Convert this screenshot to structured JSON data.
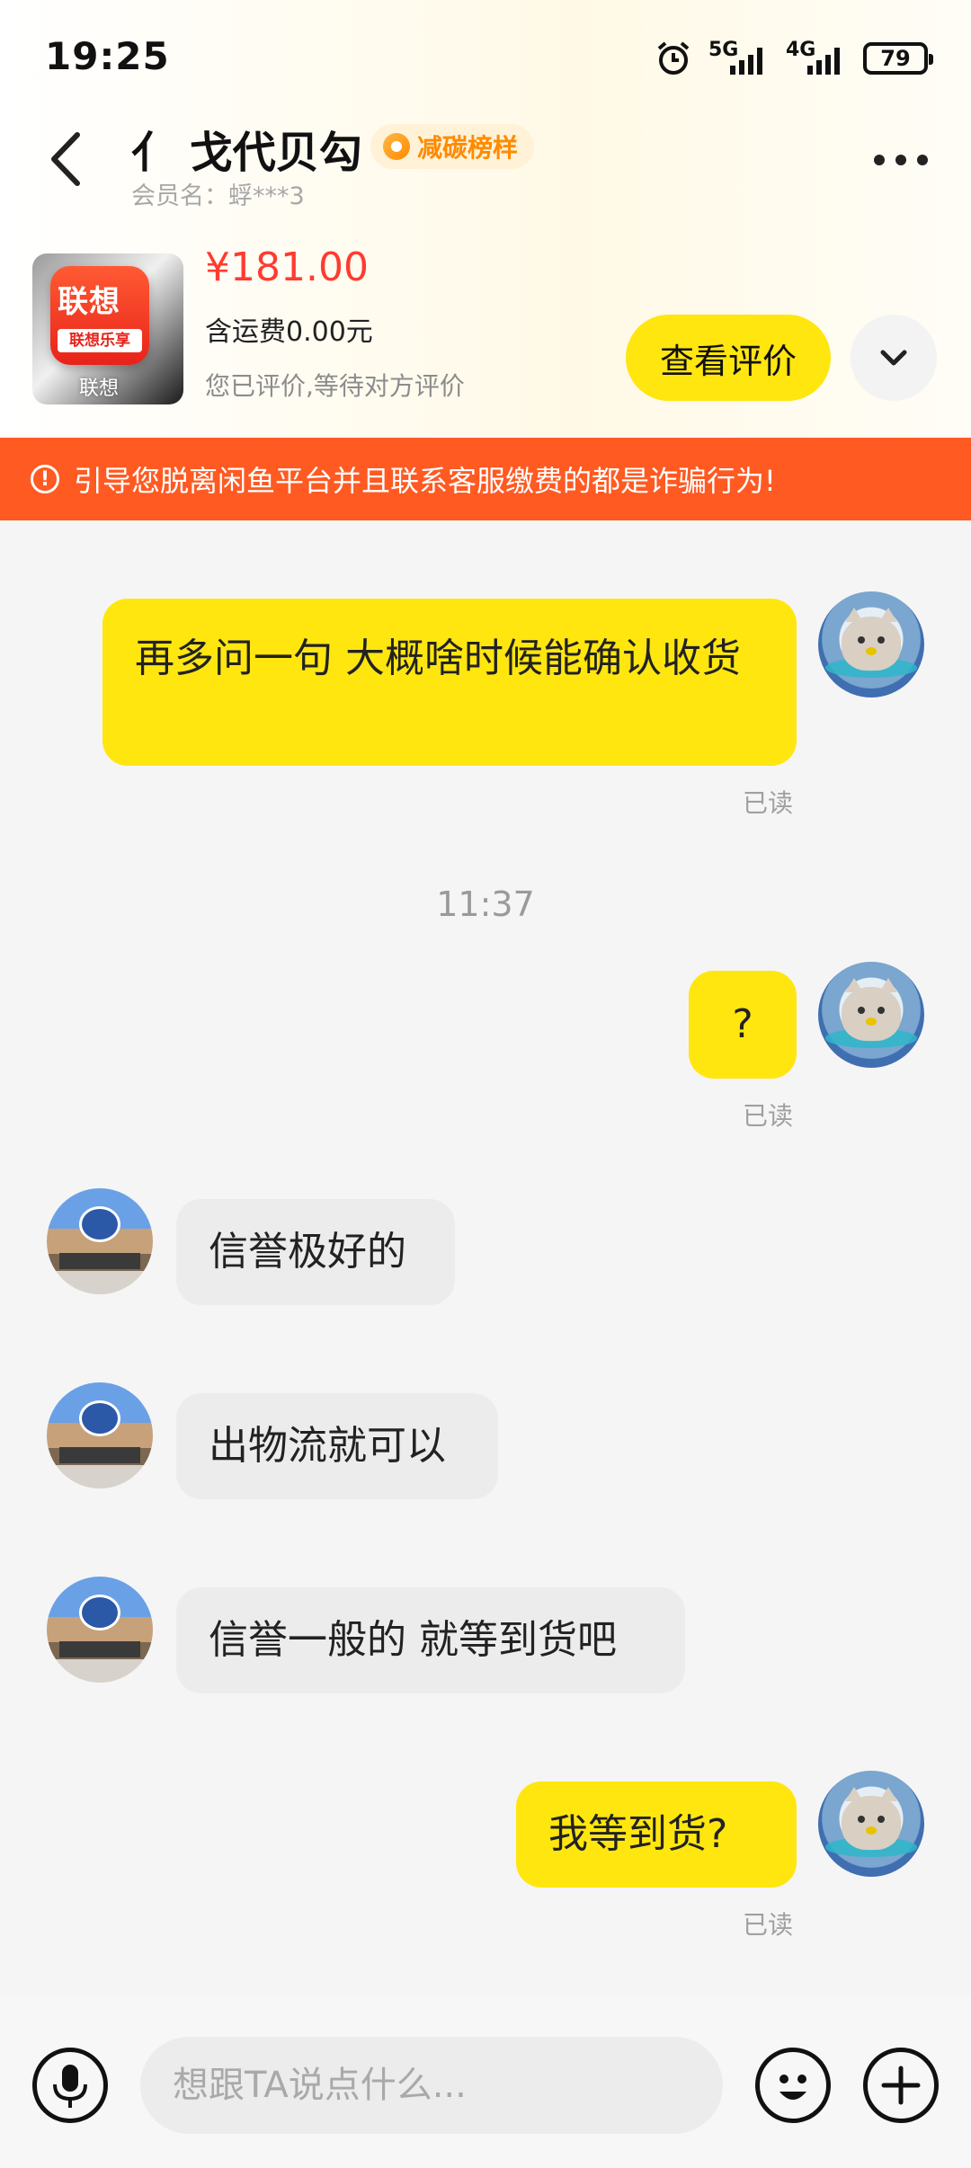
{
  "status_bar": {
    "time": "19:25",
    "net1": "5G",
    "net2": "4G",
    "battery": "79"
  },
  "header": {
    "title": "亻 戈代贝勾",
    "badge": "减碳榜样",
    "member": "会员名：蜉***3"
  },
  "product": {
    "thumb_big": "联想",
    "thumb_small": "联想乐享",
    "thumb_caption": "联想",
    "price": "¥181.00",
    "shipping": "含运费0.00元",
    "review_status": "您已评价,等待对方评价",
    "view_review_label": "查看评价"
  },
  "warning": "引导您脱离闲鱼平台并且联系客服缴费的都是诈骗行为!",
  "chat": {
    "m1": "再多问一句 大概啥时候能确认收货",
    "read1": "已读",
    "timestamp": "11:37",
    "m2": "?",
    "read2": "已读",
    "m3": "信誉极好的",
    "m4": "出物流就可以",
    "m5": "信誉一般的 就等到货吧",
    "m6": "我等到货?",
    "read3": "已读"
  },
  "input": {
    "placeholder": "想跟TA说点什么..."
  },
  "colors": {
    "accent": "#ffe60f",
    "price": "#ff3b30",
    "warning": "#ff5a22"
  }
}
